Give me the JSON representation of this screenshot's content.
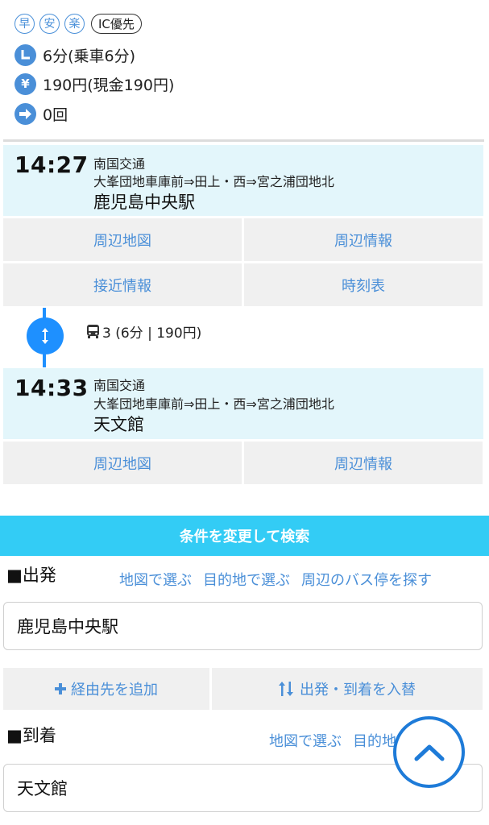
{
  "summary": {
    "tags": {
      "fast": "早",
      "safe": "安",
      "easy": "楽",
      "ic": "IC優先"
    },
    "duration": "6分(乗車6分)",
    "fare": "190円(現金190円)",
    "transfers": "0回",
    "icons": {
      "clock": "clock-icon",
      "yen": "yen-icon",
      "transfer": "arrow-right-icon"
    }
  },
  "departure_station": {
    "time": "14:27",
    "company": "南国交通",
    "route": "大峯団地車庫前⇒田上・西⇒宮之浦団地北",
    "name": "鹿児島中央駅",
    "buttons": {
      "map": "周辺地図",
      "info": "周辺情報",
      "approach": "接近情報",
      "timetable": "時刻表"
    }
  },
  "ride": {
    "text": "3 (6分 | 190円)",
    "icon": "bus-icon"
  },
  "arrival_station": {
    "time": "14:33",
    "company": "南国交通",
    "route": "大峯団地車庫前⇒田上・西⇒宮之浦団地北",
    "name": "天文館",
    "buttons": {
      "map": "周辺地図",
      "info": "周辺情報"
    }
  },
  "search": {
    "banner": "条件を変更して検索",
    "origin": {
      "label": "■出発",
      "links": {
        "map": "地図で選ぶ",
        "dest": "目的地で選ぶ",
        "nearby": "周辺のバス停を探す"
      },
      "value": "鹿児島中央駅"
    },
    "add_via": "経由先を追加",
    "swap": "出発・到着を入替",
    "destination": {
      "label": "■到着",
      "links": {
        "map": "地図で選ぶ",
        "dest": "目的地で選ぶ"
      },
      "value": "天文館"
    }
  },
  "colors": {
    "accent": "#1e90ff",
    "link": "#4a8fd8",
    "banner": "#33ccf5",
    "station_bg": "#e3f6fb",
    "button_bg": "#f0f0f0"
  }
}
